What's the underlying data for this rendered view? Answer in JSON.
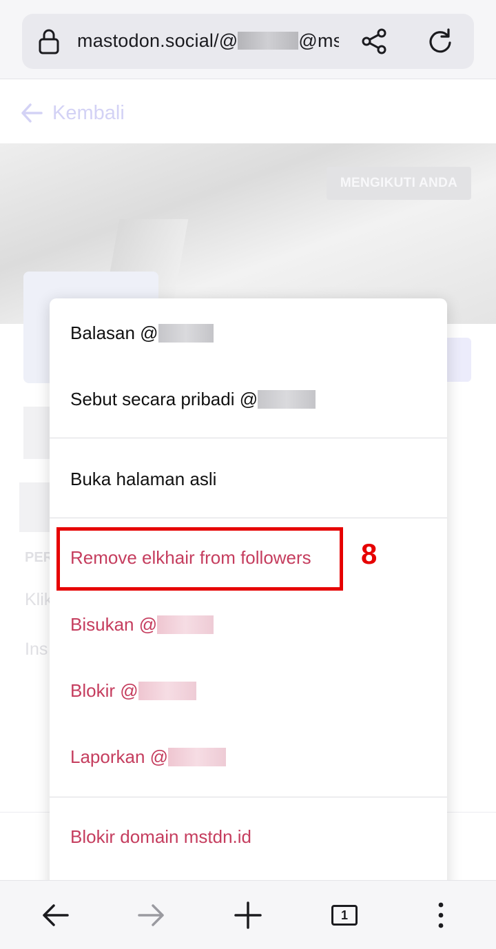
{
  "browser": {
    "url_prefix": "mastodon.social/@",
    "url_suffix": "@mst",
    "tab_count": "1"
  },
  "page": {
    "back_label": "Kembali",
    "follows_you_badge": "MENGIKUTI ANDA",
    "ghost_section": "PER",
    "ghost_line1": "Klik",
    "ghost_line2": "Ins"
  },
  "menu": {
    "items": [
      {
        "label": "Balasan @",
        "style": "normal"
      },
      {
        "label": "Sebut secara pribadi @",
        "style": "normal"
      },
      {
        "label": "Buka halaman asli",
        "style": "normal"
      },
      {
        "label": "Remove elkhair from followers",
        "style": "danger"
      },
      {
        "label": "Bisukan @",
        "style": "danger"
      },
      {
        "label": "Blokir @",
        "style": "danger"
      },
      {
        "label": "Laporkan @",
        "style": "danger"
      },
      {
        "label": "Blokir domain mstdn.id",
        "style": "danger"
      }
    ]
  },
  "annotation": {
    "step_number": "8",
    "color": "#e60000"
  },
  "colors": {
    "danger_text": "#c53d5e",
    "normal_text": "#111111",
    "accent_faded": "#d3d2f5"
  },
  "icons": {
    "lock": "lock-icon",
    "share": "share-icon",
    "reload": "reload-icon",
    "back": "arrow-left-icon",
    "forward": "arrow-right-icon",
    "new_tab": "plus-icon",
    "tabs": "tab-count-icon",
    "more": "more-vertical-icon"
  }
}
